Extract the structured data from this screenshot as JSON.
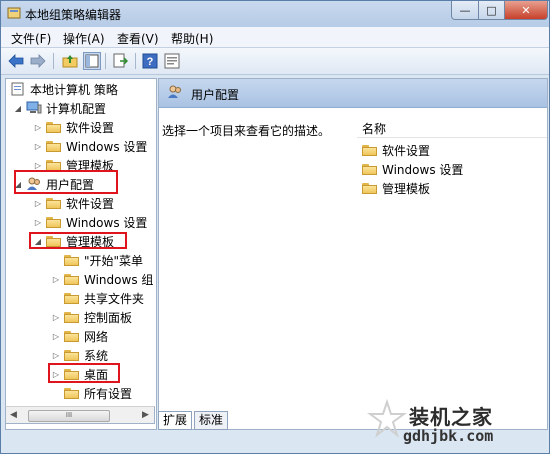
{
  "window": {
    "title": "本地组策略编辑器",
    "close_glyph": "✕",
    "max_glyph": "□",
    "min_glyph": "—"
  },
  "menu": [
    "文件(F)",
    "操作(A)",
    "查看(V)",
    "帮助(H)"
  ],
  "toolbar": {
    "icons": [
      "back-arrow-icon",
      "forward-arrow-icon",
      "up-folder-icon",
      "show-tree-icon",
      "export-list-icon",
      "help-icon",
      "properties-icon"
    ]
  },
  "tree": {
    "root": "本地计算机 策略",
    "computer_config": "计算机配置",
    "cc_children": [
      "软件设置",
      "Windows 设置",
      "管理模板"
    ],
    "user_config": "用户配置",
    "uc_children": [
      "软件设置",
      "Windows 设置",
      "管理模板"
    ],
    "admin_templates_children": [
      "\"开始\"菜单",
      "Windows 组",
      "共享文件夹",
      "控制面板",
      "网络",
      "系统",
      "桌面",
      "所有设置"
    ],
    "scroll_thumb": "III"
  },
  "right_pane": {
    "header": "用户配置",
    "description": "选择一个项目来查看它的描述。",
    "column_name": "名称",
    "items": [
      "软件设置",
      "Windows 设置",
      "管理模板"
    ]
  },
  "tabs": [
    "扩展",
    "标准"
  ],
  "watermark": {
    "text": "装机之家",
    "url": "gdhjbk.com"
  },
  "colors": {
    "highlight_box": "#e0141c",
    "pane_header": "#aac3e3",
    "folder": "#efc65a"
  }
}
